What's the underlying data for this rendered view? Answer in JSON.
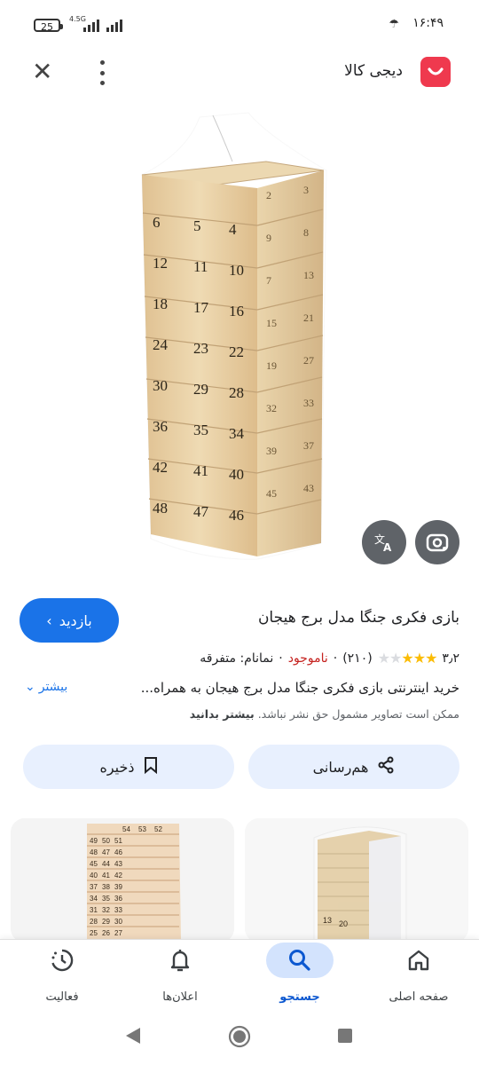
{
  "status_bar": {
    "battery": "25",
    "network": "4.5G",
    "time": "۱۶:۴۹"
  },
  "header": {
    "site_name": "دیجی کالا",
    "close_icon": "close-icon",
    "menu_icon": "more-vert-icon"
  },
  "product": {
    "title": "بازی فکری جنگا مدل برج هیجان",
    "visit_label": "بازدید",
    "rating": "۳٫۲",
    "review_count": "(۲۱۰)",
    "stars_filled": 3,
    "availability": "ناموجود",
    "brand": "نمانام: متفرقه",
    "description": "خرید اینترنتی بازی فکری جنگا مدل برج هیجان به همراه...",
    "more_label": "بیشتر",
    "copyright_notice": "ممکن است تصاویر مشمول حق نشر نباشد.",
    "learn_more": "بیشتر بدانید",
    "share_label": "هم‌رسانی",
    "save_label": "ذخیره"
  },
  "block_numbers": [
    [
      "6",
      "5",
      "4"
    ],
    [
      "12",
      "11",
      "10"
    ],
    [
      "18",
      "17",
      "16"
    ],
    [
      "24",
      "23",
      "22"
    ],
    [
      "30",
      "29",
      "28"
    ],
    [
      "36",
      "35",
      "34"
    ],
    [
      "42",
      "41",
      "40"
    ],
    [
      "48",
      "47",
      "46"
    ]
  ],
  "side_numbers": [
    "2",
    "3",
    "9",
    "8",
    "7",
    "13",
    "15",
    "21",
    "19",
    "27",
    "32",
    "33",
    "39",
    "37",
    "45",
    "43"
  ],
  "thumb_numbers": [
    "54",
    "53",
    "52",
    "49",
    "50",
    "51",
    "48",
    "47",
    "46",
    "45",
    "44",
    "43",
    "40",
    "41",
    "42",
    "37",
    "38",
    "39",
    "34",
    "35",
    "36",
    "31",
    "32",
    "33",
    "28",
    "29",
    "30",
    "25",
    "26",
    "27"
  ],
  "thumb2_numbers": [
    "13",
    "20"
  ],
  "bottom_nav": [
    {
      "label": "فعالیت",
      "icon": "activity-icon"
    },
    {
      "label": "اعلان‌ها",
      "icon": "bell-icon"
    },
    {
      "label": "جستجو",
      "icon": "search-icon"
    },
    {
      "label": "صفحه اصلی",
      "icon": "home-icon"
    }
  ],
  "colors": {
    "accent": "#1a73e8",
    "brand": "#ef394e",
    "out_of_stock": "#c5221f",
    "star": "#fbbc04"
  }
}
